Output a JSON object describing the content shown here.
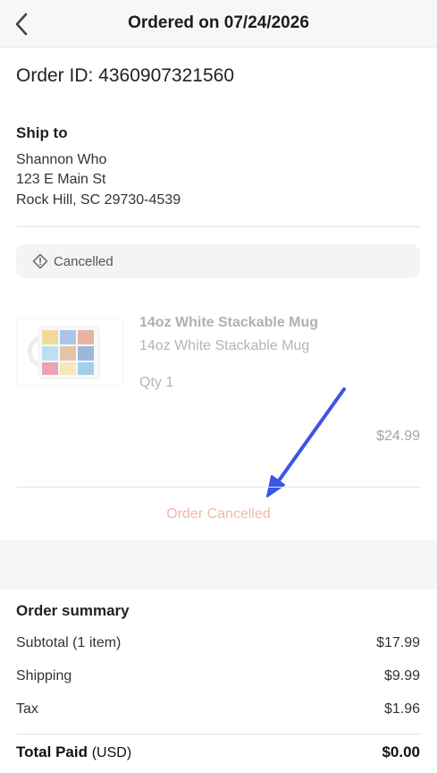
{
  "header": {
    "title": "Ordered on 07/24/2026"
  },
  "order": {
    "id_text": "Order ID: 4360907321560"
  },
  "ship_to": {
    "heading": "Ship to",
    "name": "Shannon Who",
    "street": "123 E Main St",
    "city": "Rock Hill, SC 29730-4539"
  },
  "status": {
    "label": "Cancelled",
    "icon": "warning-diamond-icon"
  },
  "item": {
    "title": "14oz White Stackable Mug",
    "variant": "14oz White Stackable Mug",
    "qty": "Qty 1",
    "price": "$24.99"
  },
  "cancel_note": "Order Cancelled",
  "summary": {
    "heading": "Order summary",
    "rows": [
      {
        "label": "Subtotal (1 item)",
        "value": "$17.99"
      },
      {
        "label": "Shipping",
        "value": "$9.99"
      },
      {
        "label": "Tax",
        "value": "$1.96"
      }
    ],
    "total_label": "Total Paid",
    "total_currency": "(USD)",
    "total_value": "$0.00"
  },
  "colors": {
    "annotation_arrow": "#3b55e6",
    "cancel_text": "#f2b9a6"
  }
}
